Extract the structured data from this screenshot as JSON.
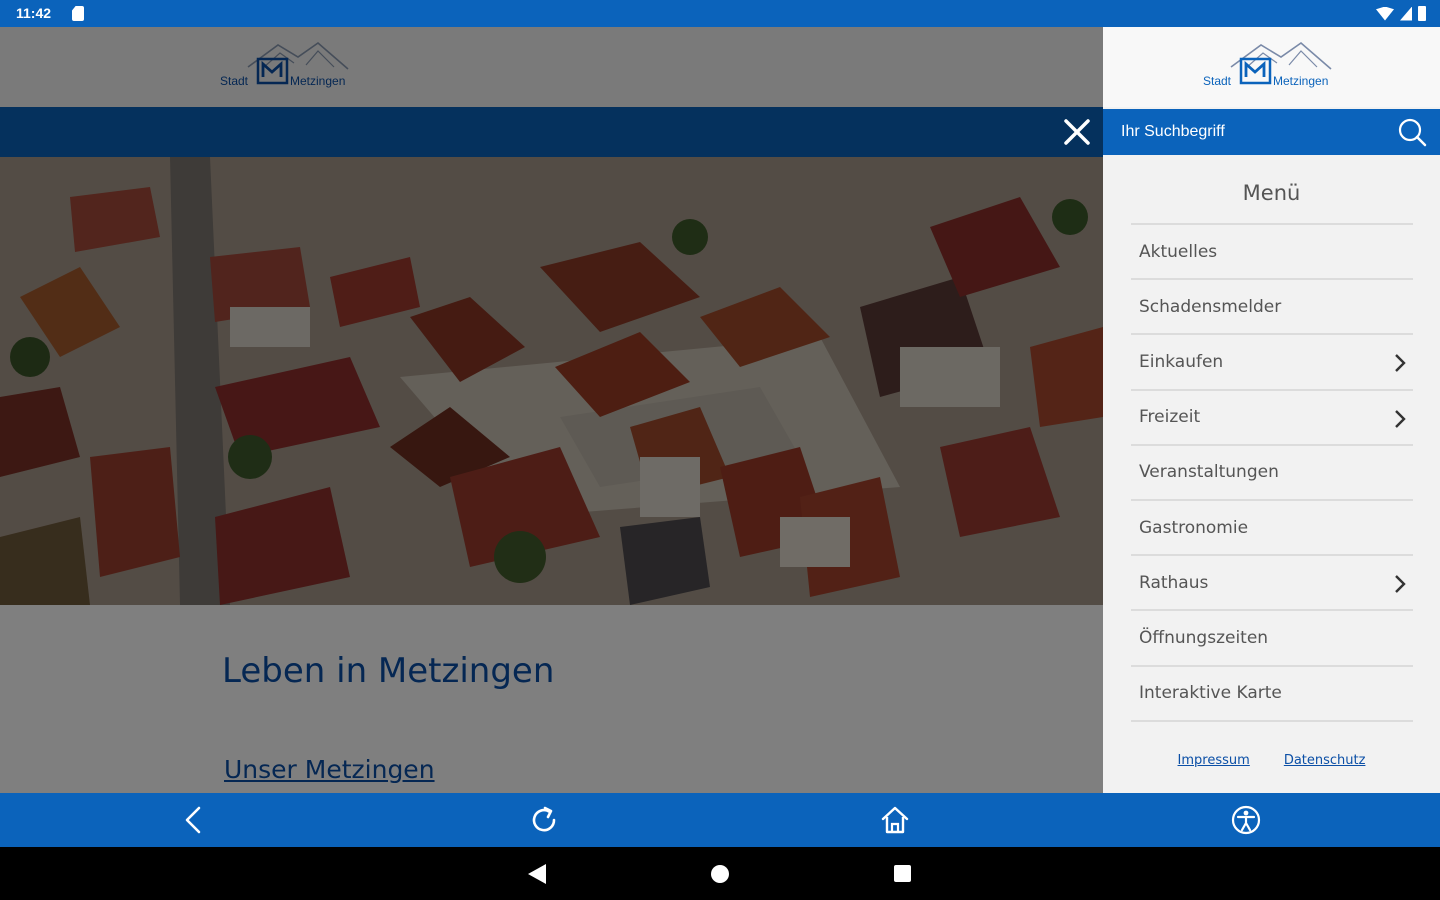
{
  "status_bar": {
    "time": "11:42"
  },
  "logo": {
    "text_left": "Stadt",
    "text_right": "Metzingen"
  },
  "content": {
    "title": "Leben in Metzingen",
    "link": "Unser Metzingen"
  },
  "search": {
    "placeholder": "Ihr Suchbegriff"
  },
  "menu": {
    "heading": "Menü",
    "items": [
      {
        "label": "Aktuelles",
        "has_submenu": false
      },
      {
        "label": "Schadensmelder",
        "has_submenu": false
      },
      {
        "label": "Einkaufen",
        "has_submenu": true
      },
      {
        "label": "Freizeit",
        "has_submenu": true
      },
      {
        "label": "Veranstaltungen",
        "has_submenu": false
      },
      {
        "label": "Gastronomie",
        "has_submenu": false
      },
      {
        "label": "Rathaus",
        "has_submenu": true
      },
      {
        "label": "Öffnungszeiten",
        "has_submenu": false
      },
      {
        "label": "Interaktive Karte",
        "has_submenu": false
      }
    ]
  },
  "footer": {
    "impressum": "Impressum",
    "datenschutz": "Datenschutz"
  },
  "colors": {
    "brand_blue": "#0b63bb",
    "link_blue": "#0b4fa6",
    "drawer_bg": "#f2f2f2"
  },
  "icons": {
    "toolbar": [
      "back-arrow-icon",
      "reload-icon",
      "home-icon",
      "accessibility-icon"
    ],
    "search": "search-icon",
    "close": "close-icon"
  }
}
